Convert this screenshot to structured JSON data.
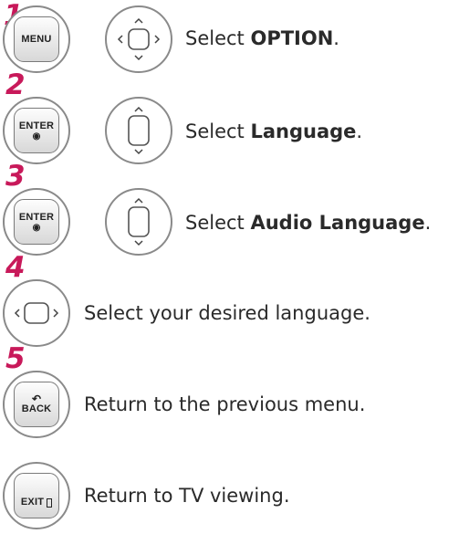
{
  "steps": [
    {
      "number": "1",
      "button_label": "MENU",
      "text_prefix": "Select ",
      "text_bold": "OPTION",
      "text_suffix": "."
    },
    {
      "number": "2",
      "button_label": "ENTER",
      "button_symbol": "◉",
      "text_prefix": "Select ",
      "text_bold": "Language",
      "text_suffix": "."
    },
    {
      "number": "3",
      "button_label": "ENTER",
      "button_symbol": "◉",
      "text_prefix": "Select ",
      "text_bold": "Audio Language",
      "text_suffix": "."
    },
    {
      "number": "4",
      "text": "Select your desired language."
    },
    {
      "number": "5",
      "button_label": "BACK",
      "button_symbol": "↶",
      "text": "Return to the previous menu."
    },
    {
      "button_label": "EXIT",
      "text": "Return to TV viewing."
    }
  ],
  "colors": {
    "step_number": "#c8195a",
    "button_border": "#7a7a7a",
    "circle_border": "#8a8a8a"
  }
}
